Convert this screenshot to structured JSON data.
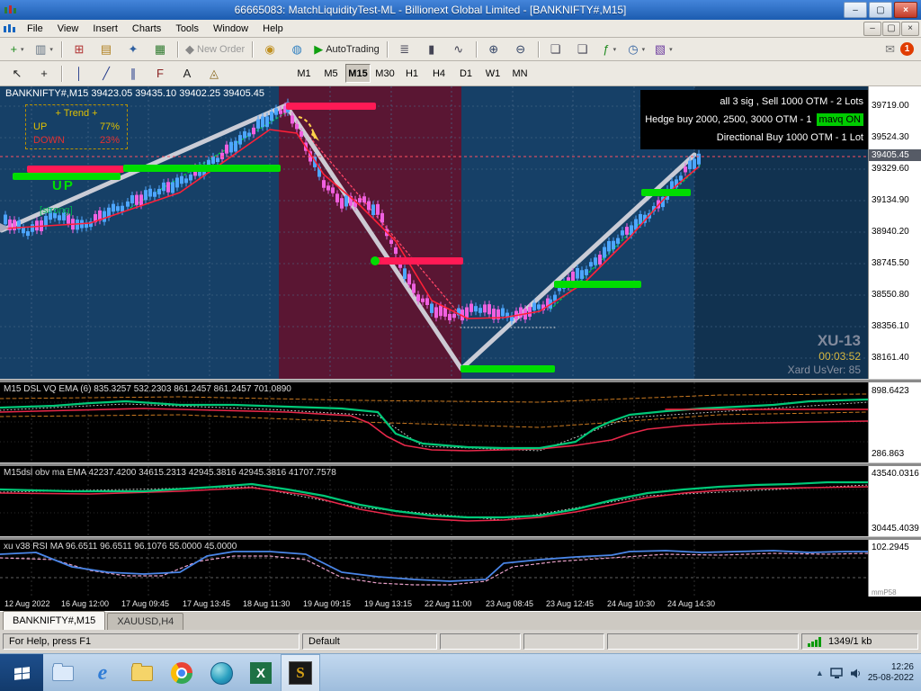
{
  "window": {
    "title": "66665083: MatchLiquidityTest-ML - Billionext Global Limited - [BANKNIFTY#,M15]",
    "minimize": "–",
    "restore": "▢",
    "close": "×"
  },
  "menu": [
    "File",
    "View",
    "Insert",
    "Charts",
    "Tools",
    "Window",
    "Help"
  ],
  "toolbar_main": {
    "buttons": [
      {
        "name": "new-chart",
        "glyph": "+",
        "color": "#1e8a1e",
        "dropdown": true
      },
      {
        "name": "profiles",
        "glyph": "▥",
        "color": "#607080",
        "dropdown": true
      },
      {
        "sep": true
      },
      {
        "name": "market-watch",
        "glyph": "⊞",
        "color": "#b03030"
      },
      {
        "name": "data-window",
        "glyph": "▤",
        "color": "#b08020"
      },
      {
        "name": "navigator",
        "glyph": "✦",
        "color": "#3060a0"
      },
      {
        "name": "terminal",
        "glyph": "▦",
        "color": "#2f7a2f"
      },
      {
        "sep": true
      },
      {
        "name": "new-order",
        "glyph": "◆",
        "color": "#888888",
        "label": "New Order",
        "label_color": "#9a9a9a"
      },
      {
        "sep": true
      },
      {
        "name": "expert-advisors",
        "glyph": "◉",
        "color": "#c09020"
      },
      {
        "name": "community",
        "glyph": "◍",
        "color": "#3080c0"
      },
      {
        "name": "autotrading",
        "glyph": "▶",
        "color": "#10a010",
        "label": "AutoTrading",
        "label_color": "#222222"
      },
      {
        "sep": true
      },
      {
        "name": "chart-bars",
        "glyph": "≣",
        "color": "#444455"
      },
      {
        "name": "chart-candles",
        "glyph": "▮",
        "color": "#444455"
      },
      {
        "name": "chart-line",
        "glyph": "∿",
        "color": "#444455"
      },
      {
        "sep": true
      },
      {
        "name": "zoom-in",
        "glyph": "⊕",
        "color": "#334466"
      },
      {
        "name": "zoom-out",
        "glyph": "⊖",
        "color": "#334466"
      },
      {
        "sep": true
      },
      {
        "name": "tile-windows",
        "glyph": "❏",
        "color": "#444455"
      },
      {
        "name": "cascade-windows",
        "glyph": "❑",
        "color": "#444455"
      },
      {
        "name": "indicators",
        "glyph": "ƒ",
        "color": "#1e8a1e",
        "dropdown": true
      },
      {
        "name": "periods",
        "glyph": "◷",
        "color": "#3060a0",
        "dropdown": true
      },
      {
        "name": "templates",
        "glyph": "▧",
        "color": "#7040a0",
        "dropdown": true
      }
    ],
    "mail_glyph": "✉",
    "notification_count": "1"
  },
  "toolbar_draw": {
    "buttons": [
      {
        "name": "cursor",
        "glyph": "↖",
        "color": "#222222"
      },
      {
        "name": "crosshair",
        "glyph": "+",
        "color": "#222222"
      },
      {
        "sep": true
      },
      {
        "name": "vertical-line",
        "glyph": "│",
        "color": "#223a8a"
      },
      {
        "name": "trendline",
        "glyph": "╱",
        "color": "#223a8a"
      },
      {
        "name": "channel",
        "glyph": "∥",
        "color": "#223a8a"
      },
      {
        "name": "fibonacci",
        "glyph": "F",
        "color": "#8a2222"
      },
      {
        "name": "text-label",
        "glyph": "A",
        "color": "#222222"
      },
      {
        "name": "arrows-shapes",
        "glyph": "◬",
        "color": "#8a6a22"
      }
    ]
  },
  "timeframes": {
    "items": [
      "M1",
      "M5",
      "M15",
      "M30",
      "H1",
      "H4",
      "D1",
      "W1",
      "MN"
    ],
    "active": "M15"
  },
  "chart": {
    "symbol_ohlc": "BANKNIFTY#,M15  39423.05 39435.10 39402.25 39405.45",
    "trend": {
      "header": "+  Trend  +",
      "up_label": "UP",
      "up_value": "77%",
      "down_label": "DOWN",
      "down_value": "23%",
      "state": "UP",
      "strength": "[strong]"
    },
    "signals": {
      "line1": "all 3 sig , Sell 1000 OTM - 2 Lots",
      "line2": "Hedge buy 2000, 2500, 3000 OTM - 1",
      "line2_badge": "mavq ON",
      "line3": "Directional Buy 1000 OTM - 1 Lot"
    },
    "watermark": {
      "title": "XU-13",
      "timer": "00:03:52",
      "version": "Xard UsVer: 85"
    },
    "current_price": "39405.45",
    "price_axis": [
      "39719.00",
      "39524.30",
      "39329.60",
      "39134.90",
      "38940.20",
      "38745.50",
      "38550.80",
      "38356.10",
      "38161.40"
    ],
    "colors": {
      "bg": "#164067",
      "zone": "#5a1633",
      "bull": "#4da6ff",
      "bear": "#f060e0",
      "up_bar": "#00dd00",
      "down_bar": "#ff1a55",
      "zigzag": "#d4d4dc",
      "ema": "#ff2038"
    }
  },
  "panels": [
    {
      "label": "M15 DSL VQ EMA (6)  835.3257 532.2303 861.2457 861.2457 701.0890",
      "axis_top": "898.6423",
      "axis_bottom": "286.863"
    },
    {
      "label": "M15dsl obv ma EMA  42237.4200 34615.2313 42945.3816 42945.3816 41707.7578",
      "axis_top": "43540.0316",
      "axis_bottom": "30445.4039"
    },
    {
      "label": "xu v38 RSI MA  96.6511 96.6511 96.1076 55.0000 45.0000",
      "axis_top": "102.2945",
      "axis_bottom": "mmP58"
    }
  ],
  "time_axis": [
    "12 Aug 2022",
    "16 Aug 12:00",
    "17 Aug 09:45",
    "17 Aug 13:45",
    "18 Aug 11:30",
    "19 Aug 09:15",
    "19 Aug 13:15",
    "22 Aug 11:00",
    "23 Aug 08:45",
    "23 Aug 12:45",
    "24 Aug 10:30",
    "24 Aug 14:30"
  ],
  "tabs": [
    {
      "label": "BANKNIFTY#,M15",
      "active": true
    },
    {
      "label": "XAUUSD,H4",
      "active": false
    }
  ],
  "statusbar": {
    "help": "For Help, press F1",
    "profile": "Default",
    "connection": "1349/1 kb"
  },
  "taskbar": {
    "icons": [
      {
        "name": "explorer",
        "type": "folder-blue"
      },
      {
        "name": "internet-explorer",
        "type": "e"
      },
      {
        "name": "folder",
        "type": "folder"
      },
      {
        "name": "chrome",
        "type": "chrome"
      },
      {
        "name": "globe-app",
        "type": "globe"
      },
      {
        "name": "excel",
        "type": "excel",
        "glyph": "X"
      },
      {
        "name": "s-app",
        "type": "s",
        "glyph": "S",
        "active": true
      }
    ],
    "clock_time": "12:26",
    "clock_date": "25-08-2022"
  }
}
